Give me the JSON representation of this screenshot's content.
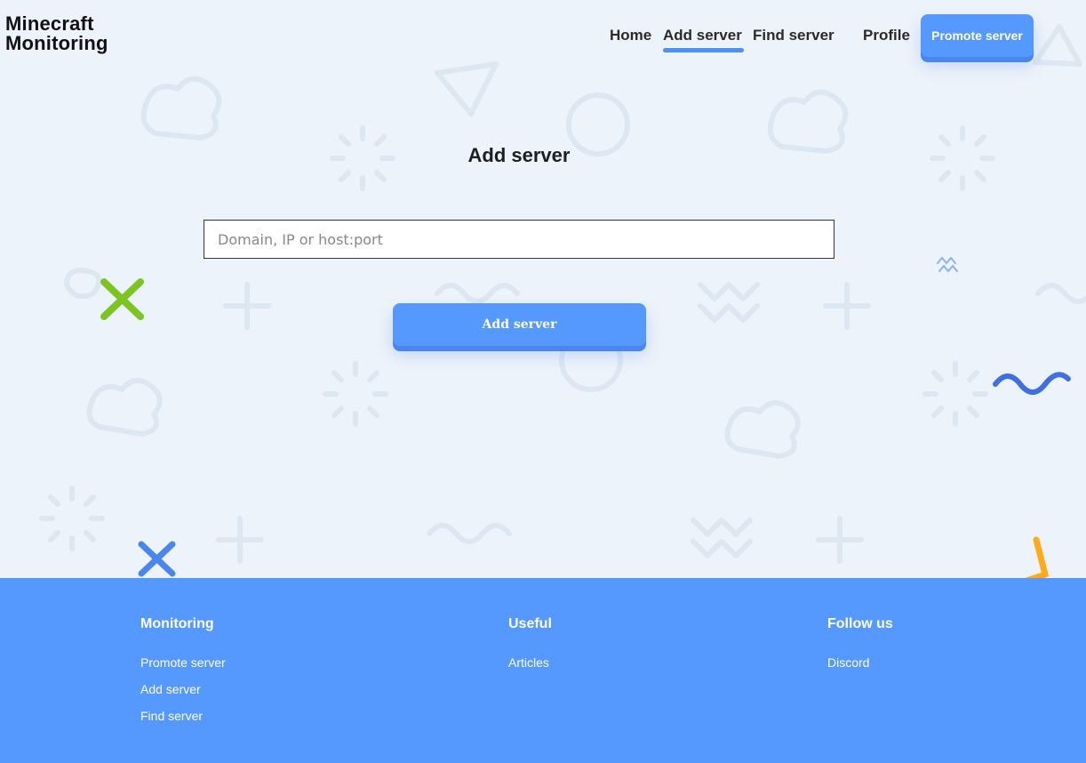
{
  "logo": {
    "line1": "Minecraft",
    "line2": "Monitoring"
  },
  "nav": {
    "home": "Home",
    "add_server": "Add server",
    "find_server": "Find server",
    "profile": "Profile",
    "promote": "Promote server"
  },
  "main": {
    "title": "Add server",
    "input_placeholder": "Domain, IP or host:port",
    "submit": "Add server"
  },
  "footer": {
    "col1": {
      "title": "Monitoring",
      "links": [
        "Promote server",
        "Add server",
        "Find server"
      ]
    },
    "col2": {
      "title": "Useful",
      "links": [
        "Articles"
      ]
    },
    "col3": {
      "title": "Follow us",
      "links": [
        "Discord"
      ]
    }
  },
  "colors": {
    "accent": "#5599ff",
    "background": "#edf3fa"
  }
}
